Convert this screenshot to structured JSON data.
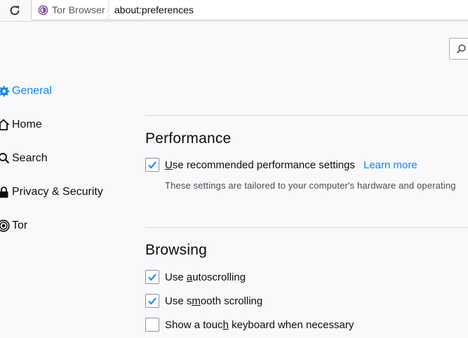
{
  "toolbar": {
    "identity_label": "Tor Browser",
    "url": "about:preferences"
  },
  "sidebar": {
    "items": [
      {
        "label": "General",
        "icon": "gear-icon",
        "selected": true
      },
      {
        "label": "Home",
        "icon": "home-icon",
        "selected": false
      },
      {
        "label": "Search",
        "icon": "search-icon",
        "selected": false
      },
      {
        "label": "Privacy & Security",
        "icon": "lock-icon",
        "selected": false
      },
      {
        "label": "Tor",
        "icon": "tor-onion-icon",
        "selected": false
      }
    ]
  },
  "performance": {
    "title": "Performance",
    "recommended": {
      "label": "Use recommended performance settings",
      "checked": true,
      "learn_more": "Learn more"
    },
    "description": "These settings are tailored to your computer's hardware and operating"
  },
  "browsing": {
    "title": "Browsing",
    "autoscrolling": {
      "pre": "Use ",
      "key": "a",
      "post": "utoscrolling",
      "checked": true
    },
    "smooth_scrolling": {
      "pre": "Use s",
      "key": "m",
      "post": "ooth scrolling",
      "checked": true
    },
    "touch_keyboard": {
      "pre": "Show a touc",
      "key": "h",
      "post": " keyboard when necessary",
      "checked": false
    }
  },
  "colors": {
    "accent": "#0a84ff",
    "check": "#0a84ff",
    "tor_purple": "#7d4698"
  }
}
